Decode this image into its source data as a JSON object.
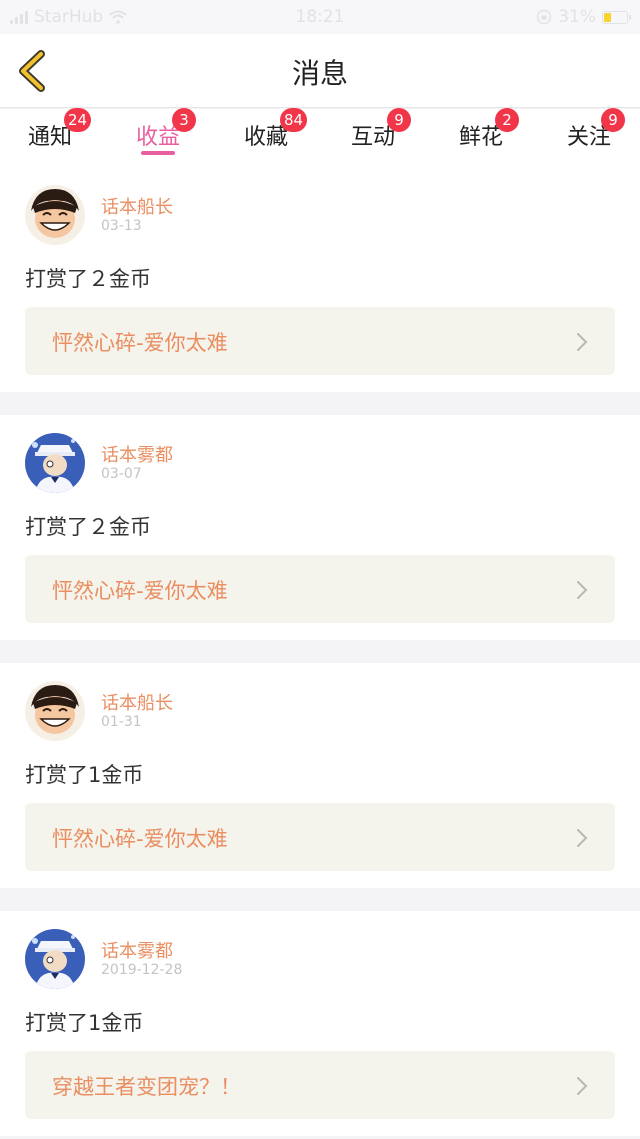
{
  "status_bar": {
    "carrier": "StarHub",
    "time": "18:21",
    "battery_percent": "31%",
    "battery_level": 0.31
  },
  "nav": {
    "title": "消息",
    "back_icon": "chevron-left-icon"
  },
  "tabs": [
    {
      "label": "通知",
      "badge": "24",
      "active": false
    },
    {
      "label": "收益",
      "badge": "3",
      "active": true
    },
    {
      "label": "收藏",
      "badge": "84",
      "active": false
    },
    {
      "label": "互动",
      "badge": "9",
      "active": false
    },
    {
      "label": "鲜花",
      "badge": "2",
      "active": false
    },
    {
      "label": "关注",
      "badge": "9",
      "active": false
    }
  ],
  "items": [
    {
      "user": "话本船长",
      "date": "03-13",
      "action": "打赏了２金币",
      "book": "怦然心碎-爱你太难",
      "avatar": "avatar-luffy"
    },
    {
      "user": "话本雾都",
      "date": "03-07",
      "action": "打赏了２金币",
      "book": "怦然心碎-爱你太难",
      "avatar": "avatar-kid"
    },
    {
      "user": "话本船长",
      "date": "01-31",
      "action": "打赏了1金币",
      "book": "怦然心碎-爱你太难",
      "avatar": "avatar-luffy"
    },
    {
      "user": "话本雾都",
      "date": "2019-12-28",
      "action": "打赏了1金币",
      "book": "穿越王者变团宠？！",
      "avatar": "avatar-kid"
    }
  ],
  "colors": {
    "accent_pink": "#e85fa0",
    "badge_red": "#f1364a",
    "name_orange": "#e98f62",
    "back_yellow": "#f2c12e"
  }
}
